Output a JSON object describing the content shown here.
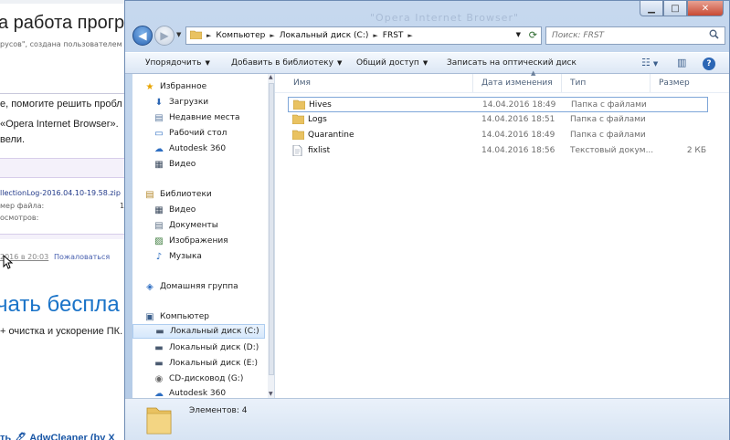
{
  "background_page": {
    "title": "а работа програ",
    "subtitle": "русов\", создана пользователем С",
    "para_line1": "е, помогите решить пробл",
    "para_line2": "«Opera Internet Browser». ",
    "para_line3": "вели.",
    "file_link": "llectionLog-2016.04.10-19.58.zip",
    "file_meta1": "мер файла:",
    "file_meta2": "осмотров:",
    "file_num": "1(",
    "date": "2016 в 20:03",
    "report": "Пожаловаться",
    "big_text": "чать беспла",
    "adv_text": "+ очистка и ускорение ПК.",
    "bottom_text": "ть 🖋 AdwCleaner (by X"
  },
  "window": {
    "ghost_title": "\"Opera Internet Browser\"",
    "controls": {
      "minimize": "▁",
      "maximize": "□",
      "close": "✕"
    },
    "address": {
      "segments": [
        "Компьютер",
        "Локальный диск (C:)",
        "FRST"
      ],
      "refresh_glyph": "⟳"
    },
    "search": {
      "placeholder": "Поиск: FRST",
      "icon": "🔍"
    },
    "toolbar": {
      "organize": "Упорядочить",
      "add_to_library": "Добавить в библиотеку",
      "share": "Общий доступ",
      "burn": "Записать на оптический диск",
      "view_icon": "☷",
      "pane_icon": "▥",
      "help_icon": "?"
    },
    "nav": {
      "favorites_header": "Избранное",
      "favorites": [
        {
          "label": "Загрузки",
          "icon": "⬇"
        },
        {
          "label": "Недавние места",
          "icon": "▤"
        },
        {
          "label": "Рабочий стол",
          "icon": "▭"
        },
        {
          "label": "Autodesk 360",
          "icon": "☁"
        },
        {
          "label": "Видео",
          "icon": "▦"
        }
      ],
      "libraries_header": "Библиотеки",
      "libraries": [
        {
          "label": "Видео",
          "icon": "▦"
        },
        {
          "label": "Документы",
          "icon": "▤"
        },
        {
          "label": "Изображения",
          "icon": "▨"
        },
        {
          "label": "Музыка",
          "icon": "♪"
        }
      ],
      "homegroup": "Домашняя группа",
      "computer_header": "Компьютер",
      "drives": [
        {
          "label": "Локальный диск (C:)",
          "icon": "▬"
        },
        {
          "label": "Локальный диск (D:)",
          "icon": "▬"
        },
        {
          "label": "Локальный диск (E:)",
          "icon": "▬"
        },
        {
          "label": "CD-дисковод (G:)",
          "icon": "◉"
        },
        {
          "label": "Autodesk 360",
          "icon": "☁"
        }
      ]
    },
    "columns": {
      "name": "Имя",
      "date": "Дата изменения",
      "type": "Тип",
      "size": "Размер"
    },
    "files": [
      {
        "name": "Hives",
        "date": "14.04.2016 18:49",
        "type": "Папка с файлами",
        "size": "",
        "kind": "folder"
      },
      {
        "name": "Logs",
        "date": "14.04.2016 18:51",
        "type": "Папка с файлами",
        "size": "",
        "kind": "folder"
      },
      {
        "name": "Quarantine",
        "date": "14.04.2016 18:49",
        "type": "Папка с файлами",
        "size": "",
        "kind": "folder"
      },
      {
        "name": "fixlist",
        "date": "14.04.2016 18:56",
        "type": "Текстовый докум...",
        "size": "2 КБ",
        "kind": "text"
      }
    ],
    "status": {
      "items_count": "Элементов: 4"
    },
    "colors": {
      "folder": "#e9c261",
      "selection": "#7ea6d8",
      "accent": "#2c66b4"
    }
  }
}
